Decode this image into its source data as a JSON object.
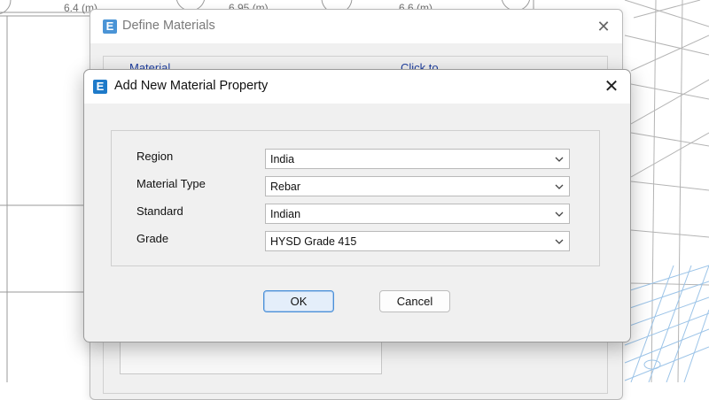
{
  "background": {
    "dimension_labels": [
      "6.4 (m)",
      "6.95 (m)",
      "6.6 (m)"
    ]
  },
  "define_materials": {
    "title": "Define Materials",
    "icon_letter": "E",
    "columns": [
      "Material",
      "Click to"
    ]
  },
  "add_material_dialog": {
    "title": "Add New Material Property",
    "icon_letter": "E",
    "fields": [
      {
        "label": "Region",
        "value": "India"
      },
      {
        "label": "Material Type",
        "value": "Rebar"
      },
      {
        "label": "Standard",
        "value": "Indian"
      },
      {
        "label": "Grade",
        "value": "HYSD Grade 415"
      }
    ],
    "ok_label": "OK",
    "cancel_label": "Cancel"
  },
  "colors": {
    "accent": "#1e7ac9",
    "dialog_bg": "#f0f0f0",
    "default_button_border": "#4a90d9"
  },
  "icons": {
    "app": "etabs-e-icon",
    "close": "close-icon",
    "dropdown": "chevron-down-icon"
  }
}
